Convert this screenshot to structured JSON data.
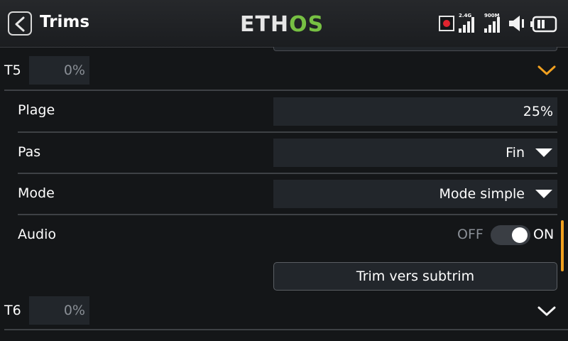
{
  "header": {
    "title": "Trims",
    "logo": {
      "part1": "ETH",
      "part2": "OS"
    },
    "status": {
      "signal1_label": "2.4G",
      "signal2_label": "900M",
      "signal1_level": 4,
      "signal2_level": 4,
      "icons": [
        "record-icon",
        "signal-2.4g-icon",
        "signal-900m-icon",
        "speaker-icon",
        "battery-icon"
      ]
    }
  },
  "trims": [
    {
      "label": "T5",
      "value": "0%",
      "expanded": true,
      "settings": {
        "range": {
          "label": "Plage",
          "value": "25%"
        },
        "step": {
          "label": "Pas",
          "value": "Fin"
        },
        "mode": {
          "label": "Mode",
          "value": "Mode simple"
        },
        "audio": {
          "label": "Audio",
          "off_label": "OFF",
          "on_label": "ON",
          "state": "on"
        },
        "action_label": "Trim vers subtrim"
      }
    },
    {
      "label": "T6",
      "value": "0%",
      "expanded": false
    }
  ],
  "colors": {
    "accent": "#f0a020",
    "logo_green": "#77c043",
    "background": "#141618",
    "field": "#22262b",
    "record": "#e0242f"
  }
}
